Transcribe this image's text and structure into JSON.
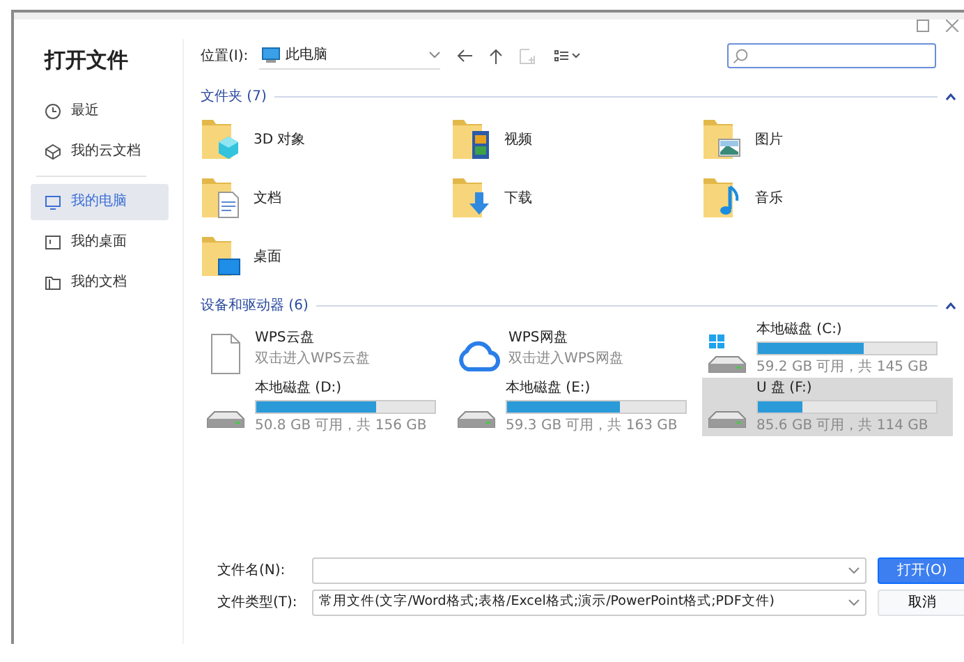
{
  "window": {
    "title": "打开文件",
    "controls": [
      {
        "kind": "maximize"
      },
      {
        "kind": "close"
      }
    ]
  },
  "sidebar": {
    "items": [
      {
        "label": "最近",
        "selected": false
      },
      {
        "label": "我的云文档",
        "selected": false
      },
      {
        "label": "我的电脑",
        "selected": true
      },
      {
        "label": "我的桌面",
        "selected": false
      },
      {
        "label": "我的文档",
        "selected": false
      }
    ]
  },
  "toolbar": {
    "location_label": "位置(I):",
    "location": "此电脑",
    "back_disabled": false,
    "up_disabled": false,
    "new_folder_disabled": true
  },
  "sections": [
    {
      "title": "文件夹 (7)",
      "expanded": true,
      "items": [
        {
          "kind": "folder",
          "name": "3D 对象"
        },
        {
          "kind": "folder",
          "name": "视频"
        },
        {
          "kind": "folder",
          "name": "图片"
        },
        {
          "kind": "folder",
          "name": "文档"
        },
        {
          "kind": "folder",
          "name": "下载"
        },
        {
          "kind": "folder",
          "name": "音乐"
        },
        {
          "kind": "folder",
          "name": "桌面"
        }
      ]
    },
    {
      "title": "设备和驱动器 (6)",
      "expanded": true,
      "items": [
        {
          "kind": "file",
          "name": "WPS云盘",
          "subtitle": "双击进入WPS云盘",
          "selected": false
        },
        {
          "kind": "cloud",
          "name": "WPS网盘",
          "subtitle": "双击进入WPS网盘",
          "selected": false
        },
        {
          "kind": "system-drive",
          "name": "本地磁盘 (C:)",
          "level": 0.59,
          "reading": "59.2 GB 可用，共 145 GB",
          "selected": false
        },
        {
          "kind": "drive",
          "name": "本地磁盘 (D:)",
          "level": 0.67,
          "reading": "50.8 GB 可用，共 156 GB",
          "selected": false
        },
        {
          "kind": "drive",
          "name": "本地磁盘 (E:)",
          "level": 0.63,
          "reading": "59.3 GB 可用，共 163 GB",
          "selected": false
        },
        {
          "kind": "drive",
          "name": "U 盘 (F:)",
          "level": 0.25,
          "reading": "85.6 GB 可用，共 114 GB",
          "selected": true
        }
      ]
    }
  ],
  "footer": {
    "filename_label": "文件名(N):",
    "filetype_label": "文件类型(T):",
    "filetype": "常用文件(文字/Word格式;表格/Excel格式;演示/PowerPoint格式;PDF文件)",
    "open_button": "打开(O)",
    "cancel_button": "取消"
  }
}
